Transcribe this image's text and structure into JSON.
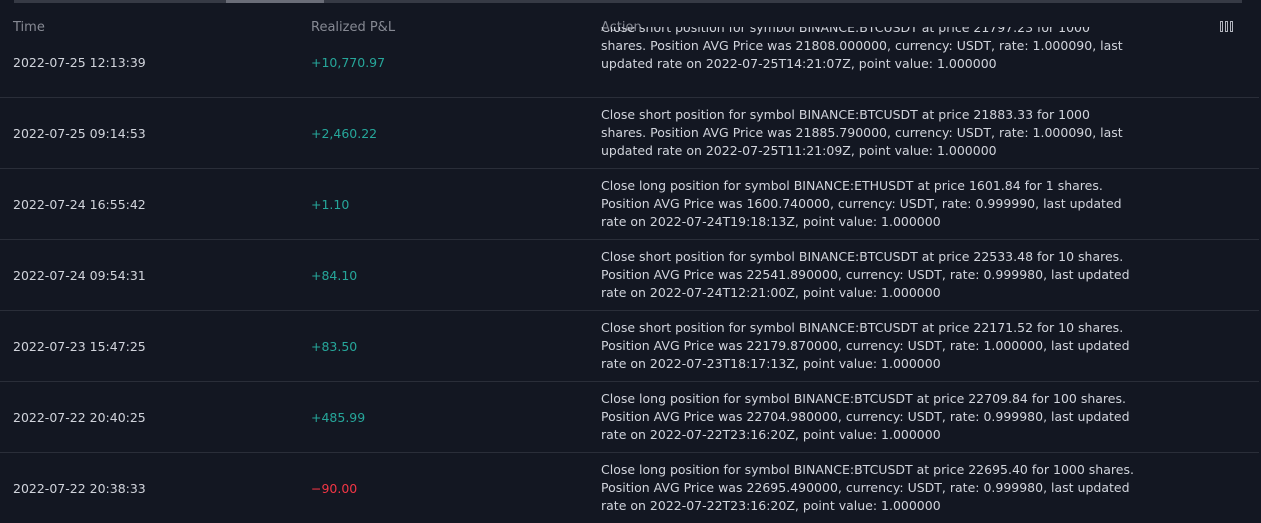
{
  "columns": {
    "time": "Time",
    "pnl": "Realized P&L",
    "action": "Action"
  },
  "rows": [
    {
      "time": "2022-07-25 12:13:39",
      "pnl": "+10,770.97",
      "sign": "pos",
      "action": "Close short position for symbol BINANCE:BTCUSDT at price 21797.23 for 1000\nshares. Position AVG Price was 21808.000000, currency: USDT, rate: 1.000090, last\nupdated rate on 2022-07-25T14:21:07Z, point value: 1.000000"
    },
    {
      "time": "2022-07-25 09:14:53",
      "pnl": "+2,460.22",
      "sign": "pos",
      "action": "Close short position for symbol BINANCE:BTCUSDT at price 21883.33 for 1000\nshares. Position AVG Price was 21885.790000, currency: USDT, rate: 1.000090, last\nupdated rate on 2022-07-25T11:21:09Z, point value: 1.000000"
    },
    {
      "time": "2022-07-24 16:55:42",
      "pnl": "+1.10",
      "sign": "pos",
      "action": "Close long position for symbol BINANCE:ETHUSDT at price 1601.84 for 1 shares.\nPosition AVG Price was 1600.740000, currency: USDT, rate: 0.999990, last updated\nrate on 2022-07-24T19:18:13Z, point value: 1.000000"
    },
    {
      "time": "2022-07-24 09:54:31",
      "pnl": "+84.10",
      "sign": "pos",
      "action": "Close short position for symbol BINANCE:BTCUSDT at price 22533.48 for 10 shares.\nPosition AVG Price was 22541.890000, currency: USDT, rate: 0.999980, last updated\nrate on 2022-07-24T12:21:00Z, point value: 1.000000"
    },
    {
      "time": "2022-07-23 15:47:25",
      "pnl": "+83.50",
      "sign": "pos",
      "action": "Close short position for symbol BINANCE:BTCUSDT at price 22171.52 for 10 shares.\nPosition AVG Price was 22179.870000, currency: USDT, rate: 1.000000, last updated\nrate on 2022-07-23T18:17:13Z, point value: 1.000000"
    },
    {
      "time": "2022-07-22 20:40:25",
      "pnl": "+485.99",
      "sign": "pos",
      "action": "Close long position for symbol BINANCE:BTCUSDT at price 22709.84 for 100 shares.\nPosition AVG Price was 22704.980000, currency: USDT, rate: 0.999980, last updated\nrate on 2022-07-22T23:16:20Z, point value: 1.000000"
    },
    {
      "time": "2022-07-22 20:38:33",
      "pnl": "−90.00",
      "sign": "neg",
      "action": "Close long position for symbol BINANCE:BTCUSDT at price 22695.40 for 1000 shares.\nPosition AVG Price was 22695.490000, currency: USDT, rate: 0.999980, last updated\nrate on 2022-07-22T23:16:20Z, point value: 1.000000"
    }
  ],
  "colors": {
    "background": "#131722",
    "positive": "#26a69a",
    "negative": "#f23645",
    "header_text": "#868993",
    "divider": "#2a2e39"
  },
  "icons": {
    "column_settings": "columns-settings-icon"
  }
}
